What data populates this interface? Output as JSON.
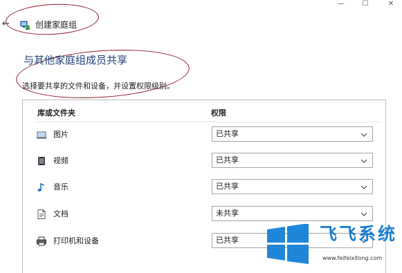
{
  "window": {
    "minimize_glyph": "—",
    "maximize_glyph": "☐",
    "close_glyph": "✕"
  },
  "nav": {
    "back_glyph": "←",
    "title": "创建家庭组",
    "icon": "homegroup-icon"
  },
  "page": {
    "heading": "与其他家庭组成员共享",
    "description": "选择要共享的文件和设备，并设置权限级别。"
  },
  "table": {
    "header_library": "库或文件夹",
    "header_permission": "权限",
    "rows": [
      {
        "label": "图片",
        "icon": "pictures-icon",
        "value": "已共享"
      },
      {
        "label": "视频",
        "icon": "videos-icon",
        "value": "已共享"
      },
      {
        "label": "音乐",
        "icon": "music-icon",
        "value": "已共享"
      },
      {
        "label": "文档",
        "icon": "documents-icon",
        "value": "未共享"
      },
      {
        "label": "打印机和设备",
        "icon": "printer-icon",
        "value": "已共享"
      }
    ]
  },
  "watermark": {
    "brand": "飞飞系统",
    "url": "www.feifeixitong.com"
  },
  "colors": {
    "heading": "#1d3f7a",
    "annotation": "#8e1b2b",
    "watermark_brand": "#1b7fd1"
  }
}
